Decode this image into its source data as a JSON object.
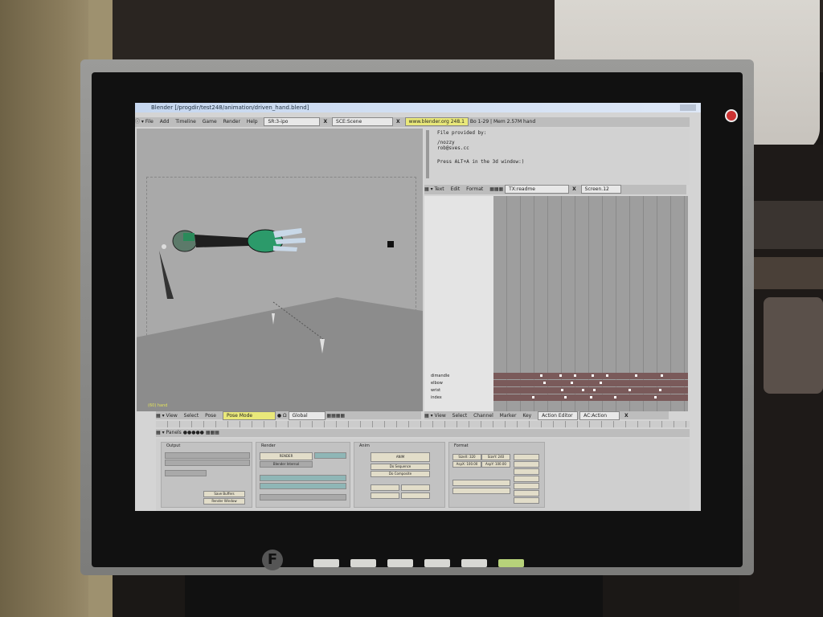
{
  "window": {
    "title": "Blender [/progdir/test248/animation/driven_hand.blend]"
  },
  "header": {
    "menus": [
      "File",
      "Add",
      "Timeline",
      "Game",
      "Render",
      "Help"
    ],
    "screen_field": "SR:3-ipo",
    "scene_field": "SCE:Scene",
    "url": "www.blender.org 248.1",
    "stats": "Bo 1-29 | Mem 2.57M hand"
  },
  "text_editor": {
    "lines": [
      "File provided by:",
      "/nozzy",
      "rob@sves.cc",
      "Press ALT+A in the 3d window:)"
    ],
    "menus": [
      "Text",
      "Edit",
      "Format"
    ],
    "text_field": "TX:readme",
    "screen_field": "Screen.12"
  },
  "viewport": {
    "object_label": "(60) hand"
  },
  "view_header": {
    "menus": [
      "View",
      "Select",
      "Pose"
    ],
    "mode": "Pose Mode",
    "orientation": "Global"
  },
  "action_editor": {
    "channels": [
      "dimandle",
      "elbow",
      "wrist",
      "index"
    ],
    "menus": [
      "View",
      "Select",
      "Channel",
      "Marker",
      "Key"
    ],
    "mode": "Action Editor",
    "action": "AC:Action"
  },
  "buttons": {
    "header": "Panels",
    "output_panel": "Output",
    "render_panel": "Render",
    "anim_panel": "Anim",
    "format_panel": "Format",
    "render_button": "RENDER",
    "anim_button": "ANIM",
    "render_engine": "Blender Internal",
    "preset_buttons": [
      "Do Sequence",
      "Do Composite"
    ],
    "size_values": [
      "SizeX: 320",
      "SizeY: 240",
      "AspX: 100.00",
      "AspY: 100.00"
    ],
    "misc_buttons": [
      "Save Buffers",
      "Render Window"
    ]
  },
  "colors": {
    "title_bar": "#c6d7ef",
    "viewport_bg": "#a9a9a9",
    "url_highlight": "#e9e87a",
    "keyframe_row": "#7a5a5a"
  }
}
